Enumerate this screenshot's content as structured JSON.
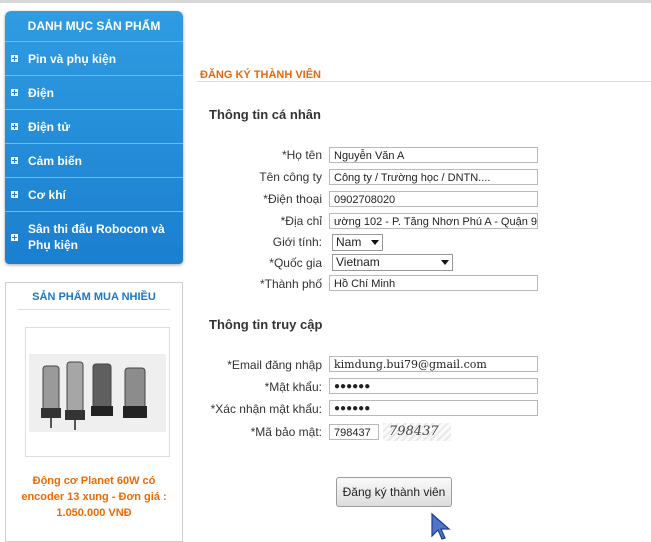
{
  "sidebar": {
    "title": "DANH MỤC SẢN PHẨM",
    "items": [
      {
        "label": "Pin và phụ kiện"
      },
      {
        "label": "Điện"
      },
      {
        "label": "Điện tử"
      },
      {
        "label": "Cảm biến"
      },
      {
        "label": "Cơ khí"
      },
      {
        "label": "Sân thi đấu Robocon và Phụ kiện"
      }
    ]
  },
  "best_sellers": {
    "title": "SẢN PHẨM MUA NHIỀU",
    "product_name": "Động cơ Planet 60W có encoder 13 xung - Đơn giá : 1.050.000 VNĐ"
  },
  "form": {
    "title": "ĐĂNG KÝ THÀNH VIÊN",
    "personal_section": "Thông tin cá nhân",
    "access_section": "Thông tin truy cập",
    "fields": {
      "fullname_label": "*Họ tên",
      "fullname_value": "Nguyễn Văn A",
      "company_label": "Tên công ty",
      "company_value": "Công ty / Trường học / DNTN....",
      "phone_label": "*Điện thoại",
      "phone_value": "0902708020",
      "address_label": "*Địa chỉ",
      "address_value": "ường 102 - P. Tăng Nhơn Phú A - Quận 9",
      "gender_label": "Giới tính:",
      "gender_value": "Nam",
      "country_label": "*Quốc gia",
      "country_value": "Vietnam",
      "city_label": "*Thành phố",
      "city_value": "Hồ Chí Minh",
      "email_label": "*Email đăng nhập",
      "email_value": "kimdung.bui79@gmail.com",
      "password_label": "*Mật khẩu:",
      "password_value": "●●●●●●",
      "confirm_label": "*Xác nhận mật khẩu:",
      "confirm_value": "●●●●●●",
      "captcha_label": "*Mã bảo mật:",
      "captcha_value": "798437",
      "captcha_image_text": "798437"
    },
    "submit_label": "Đăng ký thành viên"
  },
  "colors": {
    "menu_blue": "#1b7fcf",
    "title_orange": "#e8680e",
    "best_title_blue": "#1b78c7"
  }
}
